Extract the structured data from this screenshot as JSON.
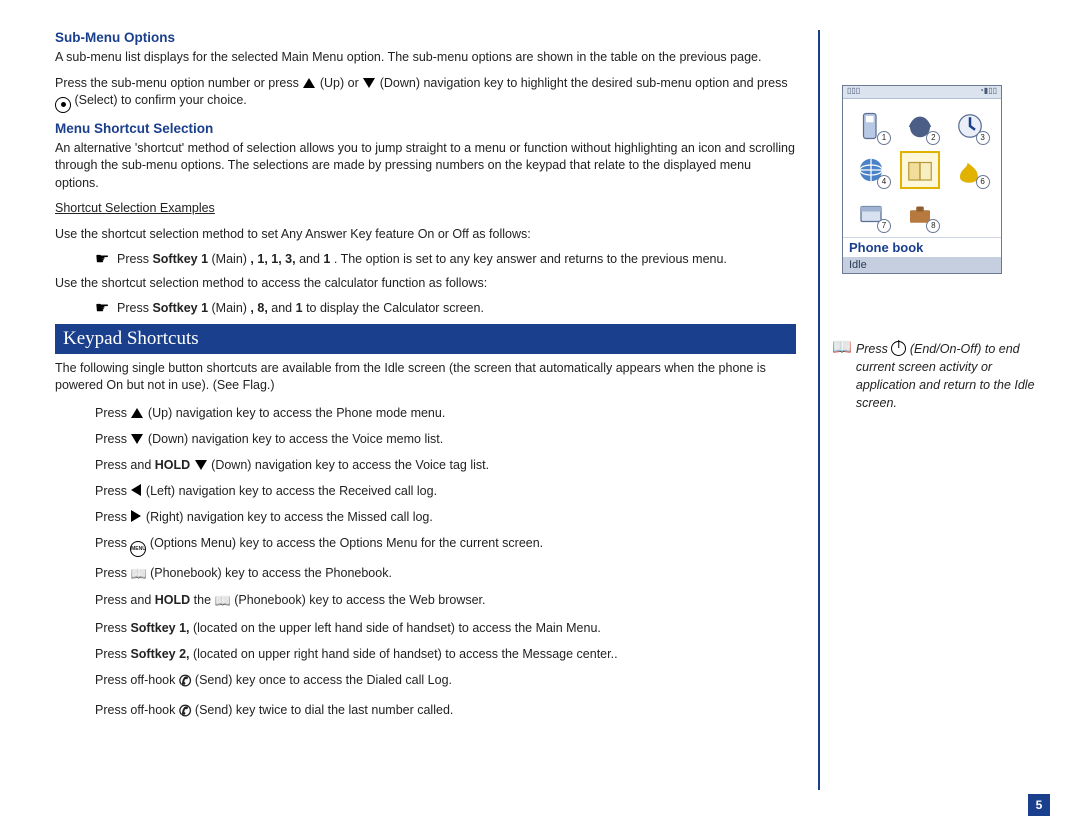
{
  "page_number": "5",
  "headings": {
    "submenu": "Sub-Menu Options",
    "shortcut": "Menu Shortcut Selection",
    "examples": "Shortcut Selection Examples",
    "band": "Keypad Shortcuts"
  },
  "submenu": {
    "p1": "A sub-menu list displays for the selected Main Menu option. The sub-menu options are shown in the table on the previous page.",
    "p2a": "Press the sub-menu option number or press ",
    "p2_up": " (Up) or ",
    "p2_down": " (Down) navigation key to highlight the desired sub-menu option and press ",
    "p2_select": " (Select) to confirm your choice."
  },
  "shortcut": {
    "p1": "An alternative 'shortcut' method of selection allows you to jump straight to a menu or function without highlighting an icon and scrolling through the sub-menu options. The selections are made by pressing numbers on the keypad that relate to the displayed menu options.",
    "ex_intro1": "Use the shortcut selection method to set Any Answer Key feature On or Off as follows:",
    "ex1_a": "Press ",
    "ex1_bold1": "Softkey 1",
    "ex1_b": " (Main)",
    "ex1_bold2": ", 1, 1, 3,",
    "ex1_c": " and ",
    "ex1_bold3": "1",
    "ex1_d": ". The option is set to any key answer and returns to the previous menu.",
    "ex_intro2": "Use the shortcut selection method to access the calculator function as follows:",
    "ex2_a": "Press ",
    "ex2_bold1": "Softkey 1",
    "ex2_b": " (Main)",
    "ex2_bold2": ", 8,",
    "ex2_c": " and ",
    "ex2_bold3": "1",
    "ex2_d": " to display the Calculator screen."
  },
  "keypad": {
    "intro": "The following single button shortcuts are available from the Idle screen (the screen that automatically appears when the phone is powered On but not in use). (See Flag.)",
    "l1a": "Press ",
    "l1b": " (Up) navigation key to access the Phone mode menu.",
    "l2a": "Press ",
    "l2b": " (Down) navigation key to access the Voice memo list.",
    "l3a": "Press and ",
    "l3bold": "HOLD",
    "l3b": " ",
    "l3c": " (Down) navigation key to access the Voice tag list.",
    "l4a": "Press ",
    "l4b": " (Left) navigation key to access the Received call log.",
    "l5a": "Press ",
    "l5b": " (Right) navigation key to access the Missed call log.",
    "l6a": "Press ",
    "l6b": " (Options Menu) key to access the Options Menu for the current screen.",
    "l7a": "Press ",
    "l7b": " (Phonebook) key to access the Phonebook.",
    "l8a": "Press and ",
    "l8bold": "HOLD",
    "l8b": " the ",
    "l8c": " (Phonebook) key to access the Web browser.",
    "l9a": "Press ",
    "l9bold": "Softkey 1,",
    "l9b": " (located on the upper left hand side of handset) to access the Main Menu.",
    "l10a": "Press ",
    "l10bold": "Softkey 2,",
    "l10b": " (located on upper right hand side of handset) to access the Message center..",
    "l11a": "Press off-hook ",
    "l11b": " (Send) key once to access the Dialed call Log.",
    "l12a": "Press off-hook ",
    "l12b": " (Send) key twice to dial the last number called."
  },
  "sidenote": {
    "a": "Press ",
    "b": " (End/On-Off) to end current screen activity or application and return to the Idle screen."
  },
  "phone": {
    "label": "Phone book",
    "idle": "Idle",
    "nums": [
      "1",
      "2",
      "3",
      "4",
      "",
      "6",
      "7",
      "8",
      ""
    ]
  }
}
